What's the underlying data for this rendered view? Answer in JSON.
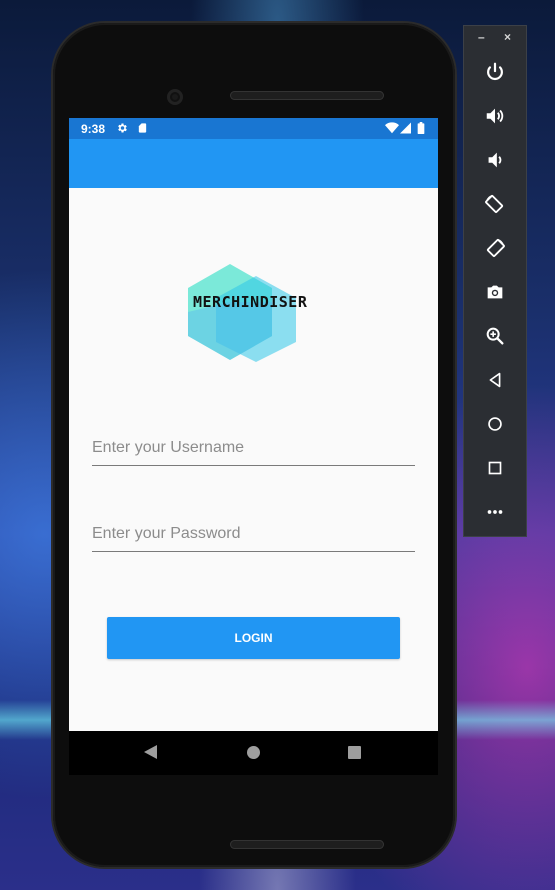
{
  "colors": {
    "primary": "#2196f3",
    "status_bar": "#1976d2",
    "screen_bg": "#fafafa",
    "toolbar_bg": "#2b2e33"
  },
  "status_bar": {
    "time": "9:38",
    "icons": [
      "settings-icon",
      "sd-card-icon",
      "wifi-icon",
      "signal-icon",
      "battery-icon"
    ]
  },
  "logo": {
    "text": "MERCHINDISER"
  },
  "login_form": {
    "username_placeholder": "Enter your Username",
    "username_value": "",
    "password_placeholder": "Enter your Password",
    "password_value": "",
    "login_label": "LOGIN"
  },
  "navigation_bar": {
    "buttons": [
      "back-icon",
      "home-icon",
      "recents-icon"
    ]
  },
  "emulator_toolbar": {
    "minimize_label": "–",
    "close_label": "×",
    "buttons": [
      "power-icon",
      "volume-up-icon",
      "volume-down-icon",
      "rotate-left-icon",
      "rotate-right-icon",
      "camera-icon",
      "zoom-icon",
      "back-icon",
      "home-icon",
      "overview-icon",
      "more-icon"
    ]
  }
}
